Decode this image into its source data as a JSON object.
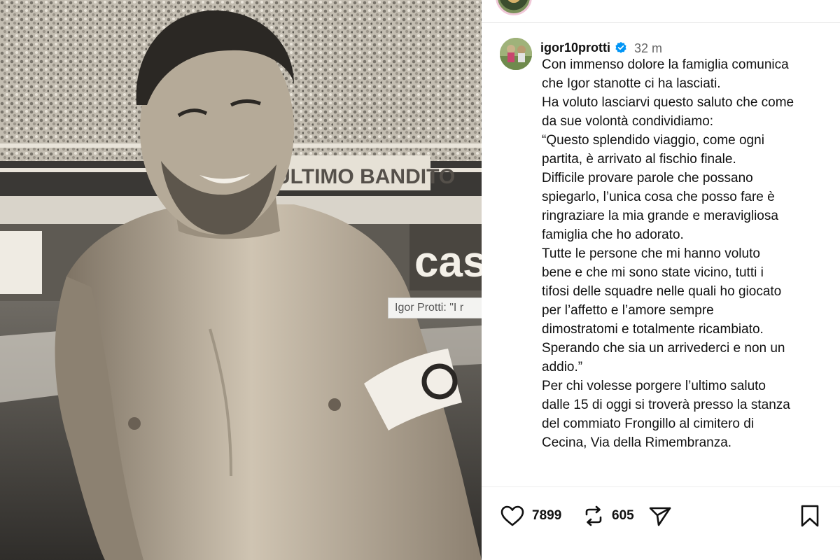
{
  "photo": {
    "banner_text": "ULTIMO BANDITO",
    "ad_text": "cas",
    "tooltip": "Igor Protti: \"I r"
  },
  "post": {
    "username": "igor10protti",
    "verified": true,
    "time": "32 m",
    "caption_lines": [
      "Con immenso dolore la famiglia comunica",
      "che Igor stanotte ci ha lasciati.",
      "Ha voluto lasciarvi questo saluto che come",
      "da sue volontà condividiamo:",
      "“Questo splendido viaggio, come ogni",
      "partita, è arrivato al fischio finale.",
      "Difficile provare parole che possano",
      "spiegarlo, l’unica cosa che posso fare è",
      "ringraziare la mia grande e meravigliosa",
      "famiglia che ho adorato.",
      "Tutte le persone che mi hanno voluto",
      "bene e che mi sono state vicino, tutti i",
      "tifosi delle squadre nelle quali ho giocato",
      "per l’affetto e l’amore sempre",
      "dimostratomi e totalmente ricambiato.",
      "Sperando che sia un arrivederci e non un",
      "addio.”",
      "Per chi volesse porgere l’ultimo saluto",
      "dalle 15 di oggi si troverà presso la stanza",
      "del commiato Frongillo al cimitero di",
      "Cecina, Via della Rimembranza."
    ]
  },
  "actions": {
    "likes": "7899",
    "reposts": "605"
  },
  "icons": {
    "like": "heart-icon",
    "repost": "repost-icon",
    "share": "send-icon",
    "save": "bookmark-icon",
    "verified": "verified-badge-icon"
  },
  "colors": {
    "verified": "#0095f6",
    "text": "#111111",
    "muted": "#666666"
  }
}
